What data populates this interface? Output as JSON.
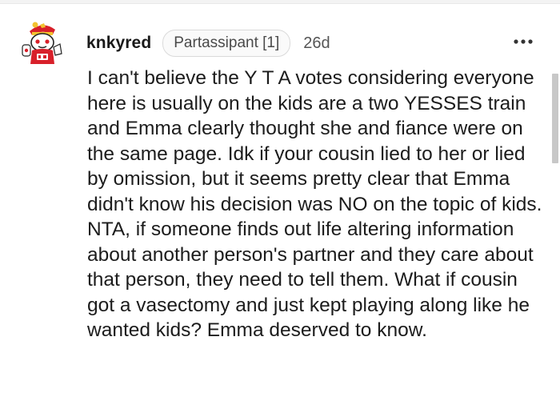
{
  "comment": {
    "username": "knkyred",
    "flair": "Partassipant [1]",
    "timestamp": "26d",
    "body": "I can't believe the Y T A votes considering everyone here is usually on the kids are a two YESSES train and Emma clearly thought she and fiance were on the same page. Idk if your cousin lied to her or lied by omission, but it seems pretty clear that Emma didn't know his decision was NO on the topic of kids. NTA, if someone finds out life altering information about another person's partner and they care about that person, they need to tell them. What if cousin got a vasectomy and just kept playing along like he wanted kids? Emma deserved to know.",
    "avatar_icon": "snoo-avatar-icon",
    "more_icon": "more-options-icon"
  },
  "colors": {
    "text": "#1c1c1c",
    "meta": "#555555",
    "flair_border": "#dadada",
    "avatar_red": "#d8202a",
    "avatar_yellow": "#f2c230"
  }
}
